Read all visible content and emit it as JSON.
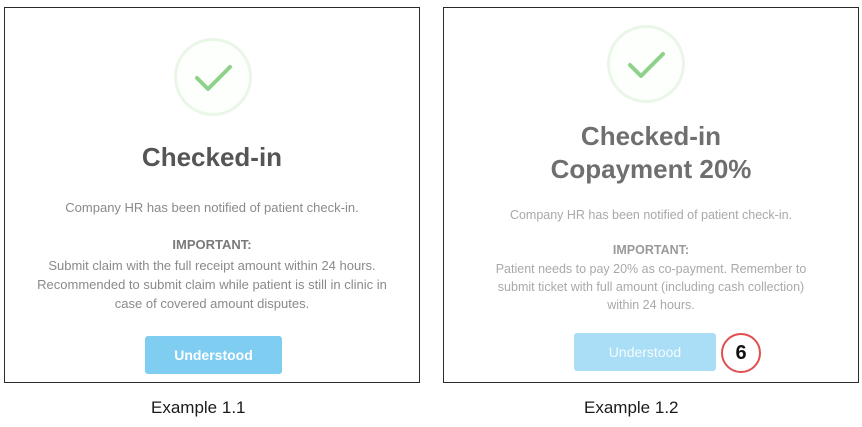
{
  "examples": [
    {
      "title": "Checked-in",
      "notice": "Company HR has been notified of patient check-in.",
      "important_heading": "IMPORTANT:",
      "important_lines": [
        "Submit claim with the full receipt amount within 24 hours.",
        "Recommended to submit claim while patient is still in clinic in",
        "case of covered amount disputes."
      ],
      "button_label": "Understood",
      "caption": "Example 1.1"
    },
    {
      "title_line1": "Checked-in",
      "title_line2": "Copayment 20%",
      "notice": "Company HR has been notified of patient check-in.",
      "important_heading": "IMPORTANT:",
      "important_lines": [
        "Patient needs to pay 20% as co-payment. Remember to",
        "submit ticket with full amount (including cash collection)",
        "within 24 hours."
      ],
      "button_label": "Understood",
      "step_badge": "6",
      "caption": "Example 1.2"
    }
  ],
  "colors": {
    "check_green": "#8fd18a",
    "button_blue": "#7fcdf1",
    "badge_red": "#e05050"
  },
  "icons": {
    "success": "checkmark-icon"
  }
}
